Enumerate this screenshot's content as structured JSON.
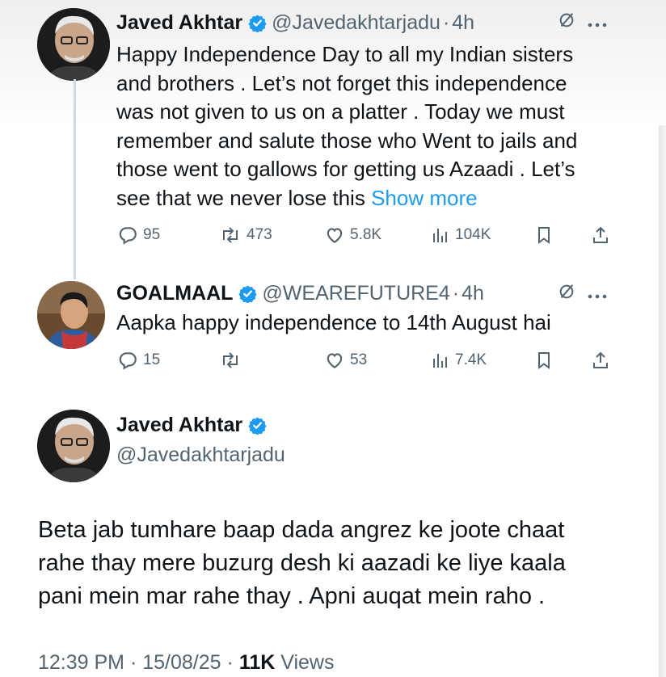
{
  "tweets": [
    {
      "name": "Javed Akhtar",
      "handle": "@Javedakhtarjadu",
      "time": "4h",
      "text_lines": [
        "Happy Independence Day  to all my Indian sisters",
        "and brothers  . Let’s not forget this independence",
        "was not given to us on a platter . Today we must",
        "remember and salute those who Went to jails and",
        "those went to gallows for getting us Azaadi . Let’s",
        "see that we never lose this"
      ],
      "show_more": "Show more",
      "replies": "95",
      "reposts": "473",
      "likes": "5.8K",
      "views": "104K"
    },
    {
      "name": "GOALMAAL",
      "handle": "@WEAREFUTURE4",
      "time": "4h",
      "text": "Aapka happy independence to 14th August hai",
      "replies": "15",
      "reposts": "",
      "likes": "53",
      "views": "7.4K"
    }
  ],
  "main": {
    "name": "Javed Akhtar",
    "handle": "@Javedakhtarjadu",
    "text_lines": [
      "Beta jab tumhare baap dada angrez ke joote chaat",
      "rahe thay mere buzurg desh ki aazadi ke liye kaala",
      "pani mein mar rahe thay . Apni auqat mein raho ."
    ],
    "time": "12:39 PM",
    "date": "15/08/25",
    "views_count": "11K",
    "views_label": "Views"
  },
  "separator": "·",
  "colors": {
    "text": "#0f1419",
    "secondary": "#536471",
    "accent": "#1d9bf0",
    "verified": "#1d9bf0"
  },
  "icons": [
    "verified-badge-icon",
    "grok-icon",
    "more-icon",
    "reply-icon",
    "repost-icon",
    "like-icon",
    "views-icon",
    "bookmark-icon",
    "share-icon"
  ]
}
